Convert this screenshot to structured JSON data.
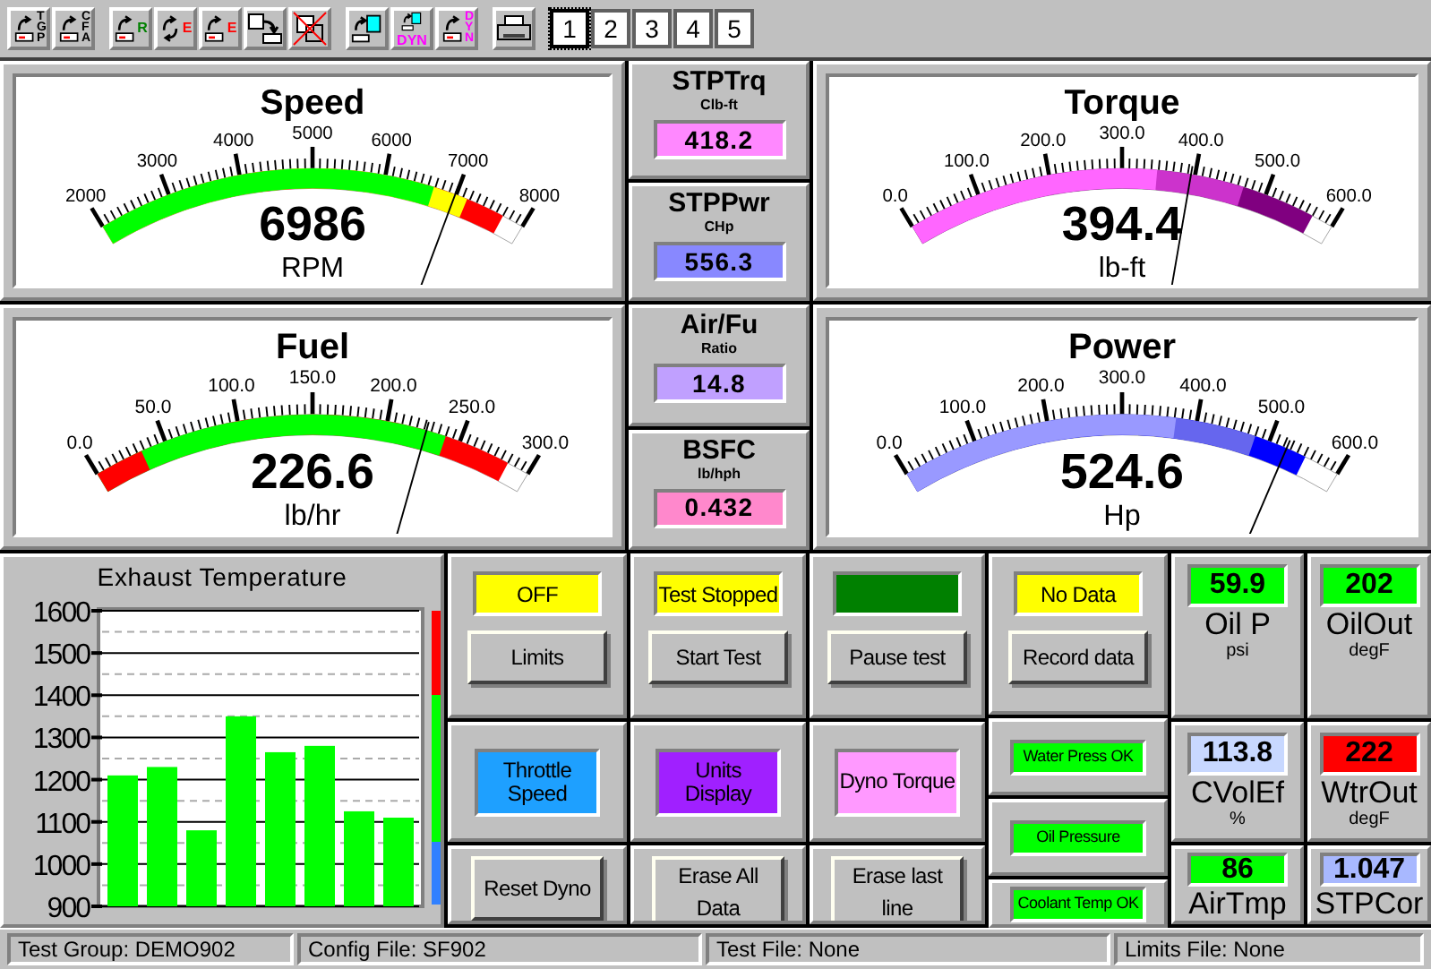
{
  "toolbar_groups": [
    {
      "tools": [
        {
          "kind": "arrow",
          "letters": "TGP",
          "vertical": true,
          "color": "#000000"
        },
        {
          "kind": "arrow",
          "letters": "CFA",
          "vertical": true,
          "color": "#000000"
        }
      ]
    },
    {
      "tools": [
        {
          "kind": "arrow",
          "letters": "R",
          "vertical": false,
          "color": "#008000"
        },
        {
          "kind": "swap",
          "letters": "E",
          "vertical": false,
          "color": "#ff0000"
        },
        {
          "kind": "arrow",
          "letters": "E",
          "vertical": false,
          "color": "#ff0000"
        },
        {
          "kind": "box-arrow"
        },
        {
          "kind": "crossed"
        }
      ]
    },
    {
      "tools": [
        {
          "kind": "doc"
        },
        {
          "kind": "doc",
          "letters": "DYN",
          "vertical": false,
          "color": "#ff00ff"
        },
        {
          "kind": "arrow",
          "letters": "DYN",
          "vertical": true,
          "color": "#ff00ff"
        }
      ]
    },
    {
      "tools": [
        {
          "kind": "printer"
        }
      ]
    }
  ],
  "pages": [
    {
      "label": "1",
      "selected": true
    },
    {
      "label": "2",
      "selected": false
    },
    {
      "label": "3",
      "selected": false
    },
    {
      "label": "4",
      "selected": false
    },
    {
      "label": "5",
      "selected": false
    }
  ],
  "gauges": [
    {
      "title": "Speed",
      "value": "6986",
      "unit": "RPM",
      "scale": [
        "2000",
        "3000",
        "4000",
        "5000",
        "6000",
        "7000",
        "8000"
      ],
      "bands": [
        {
          "color": "#00ff00",
          "level": 0.78
        },
        {
          "color": "#ffff00",
          "level": 0.86
        },
        {
          "color": "#ff0000",
          "level": 0.95
        }
      ]
    },
    {
      "title": "Torque",
      "value": "394.4",
      "unit": "lb-ft",
      "scale": [
        "0.0",
        "100.0",
        "200.0",
        "300.0",
        "400.0",
        "500.0",
        "600.0"
      ],
      "bands": [
        {
          "color": "#ff66ff",
          "level": 0.58
        },
        {
          "color": "#cc33cc",
          "level": 0.78
        },
        {
          "color": "#800080",
          "level": 0.95
        }
      ]
    },
    {
      "title": "Fuel",
      "value": "226.6",
      "unit": "lb/hr",
      "scale": [
        "0.0",
        "50.0",
        "100.0",
        "150.0",
        "200.0",
        "250.0",
        "300.0"
      ],
      "bands": [
        {
          "color": "#ff0000",
          "level": 0.11
        },
        {
          "color": "#00ff00",
          "level": 0.8
        },
        {
          "color": "#ff0000",
          "level": 0.95
        }
      ]
    },
    {
      "title": "Power",
      "value": "524.6",
      "unit": "Hp",
      "scale": [
        "0.0",
        "100.0",
        "200.0",
        "300.0",
        "400.0",
        "500.0",
        "600.0"
      ],
      "bands": [
        {
          "color": "#9999ff",
          "level": 0.62
        },
        {
          "color": "#6666ee",
          "level": 0.8
        },
        {
          "color": "#0000ff",
          "level": 0.92
        }
      ]
    }
  ],
  "readouts": [
    {
      "title": "STPTrq",
      "unit": "Clb-ft",
      "value": "418.2",
      "color": "#ff88ff"
    },
    {
      "title": "STPPwr",
      "unit": "CHp",
      "value": "556.3",
      "color": "#8888ff"
    },
    {
      "title": "Air/Fu",
      "unit": "Ratio",
      "value": "14.8",
      "color": "#c0a0ff"
    },
    {
      "title": "BSFC",
      "unit": "lb/hph",
      "value": "0.432",
      "color": "#ff88cc"
    }
  ],
  "exhaust": {
    "chart_data": {
      "type": "bar",
      "title": "Exhaust Temperature",
      "ylim": [
        900,
        1600
      ],
      "yticks": [
        900,
        1000,
        1100,
        1200,
        1300,
        1400,
        1500,
        1600
      ],
      "grid": true,
      "series": [
        {
          "color": "#00ff00",
          "values": [
            1210,
            1230,
            1080,
            1350,
            1265,
            1280,
            1125,
            1110
          ]
        }
      ]
    }
  },
  "control_columns": [
    {
      "cells": [
        {
          "kind": "indicator_button",
          "indicator": "OFF",
          "color": "#ffff00",
          "button": "Limits"
        },
        {
          "kind": "color_button",
          "label": "Throttle Speed",
          "color": "#1ea0ff"
        },
        {
          "kind": "button",
          "label": "Reset Dyno"
        }
      ]
    },
    {
      "cells": [
        {
          "kind": "indicator_button",
          "indicator": "Test Stopped",
          "color": "#ffff00",
          "button": "Start Test"
        },
        {
          "kind": "color_button",
          "label": "Units Display",
          "color": "#a020ff"
        },
        {
          "kind": "button",
          "label": "Erase All Data"
        }
      ]
    },
    {
      "cells": [
        {
          "kind": "indicator_button",
          "color": "#008000",
          "button": "Pause test"
        },
        {
          "kind": "color_button",
          "label": "Dyno Torque",
          "color": "#ff99ff"
        },
        {
          "kind": "button",
          "label": "Erase last line"
        }
      ]
    },
    {
      "cells": [
        {
          "kind": "indicator_button",
          "indicator": "No Data",
          "color": "#ffff00",
          "button": "Record data"
        },
        {
          "kind": "status_light",
          "label": "Water Press OK",
          "color": "#00ff00"
        },
        {
          "kind": "status_light",
          "label": "Oil Pressure",
          "color": "#00ff00"
        },
        {
          "kind": "status_light",
          "label": "Coolant Temp OK",
          "color": "#00ff00"
        }
      ]
    },
    {
      "cells": [
        {
          "kind": "readout",
          "value": "59.9",
          "name": "Oil P",
          "unit": "psi",
          "color": "#00ff00"
        },
        {
          "kind": "readout",
          "value": "113.8",
          "name": "CVolEf",
          "unit": "%",
          "color": "#c8d8ff"
        },
        {
          "kind": "readout",
          "value": "86",
          "name": "AirTmp",
          "color": "#00ff00"
        }
      ]
    },
    {
      "cells": [
        {
          "kind": "readout",
          "value": "202",
          "name": "OilOut",
          "unit": "degF",
          "color": "#00ff00"
        },
        {
          "kind": "readout",
          "value": "222",
          "name": "WtrOut",
          "unit": "degF",
          "color": "#ff0000"
        },
        {
          "kind": "readout",
          "value": "1.047",
          "name": "STPCor",
          "color": "#a8b8ff"
        }
      ]
    }
  ],
  "status_bar": [
    "Test Group: DEMO902",
    "Config File: SF902",
    "Test File: None",
    "Limits File: None"
  ]
}
